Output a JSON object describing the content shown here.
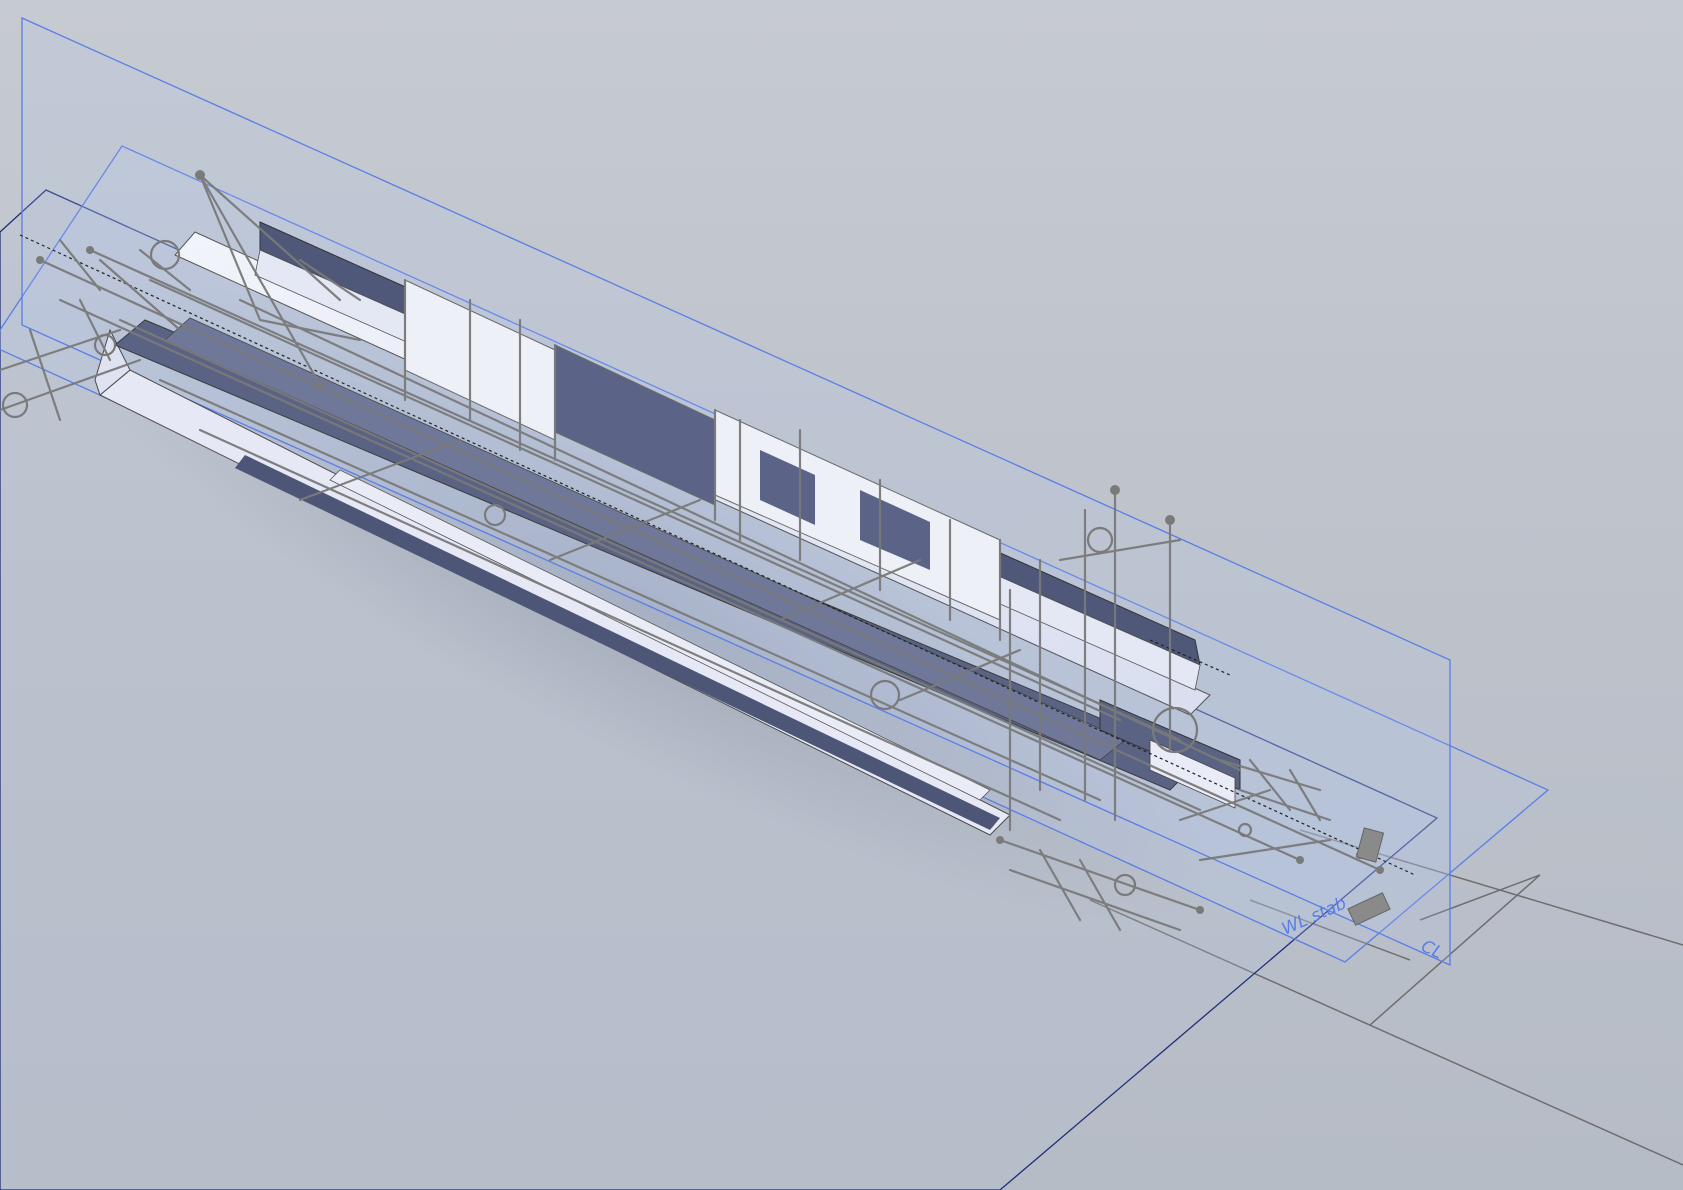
{
  "viewport": {
    "name": "3d-model-viewport"
  },
  "planes": {
    "waterline_label": "WL stab",
    "centerline_label": "CL"
  },
  "colors": {
    "background": "#c0c5cd",
    "plane_edge": "#5a7ee6",
    "sketch_lines": "#7d7d7d",
    "hull_face": "#e9ecf7",
    "hull_dark": "#525a7a"
  }
}
